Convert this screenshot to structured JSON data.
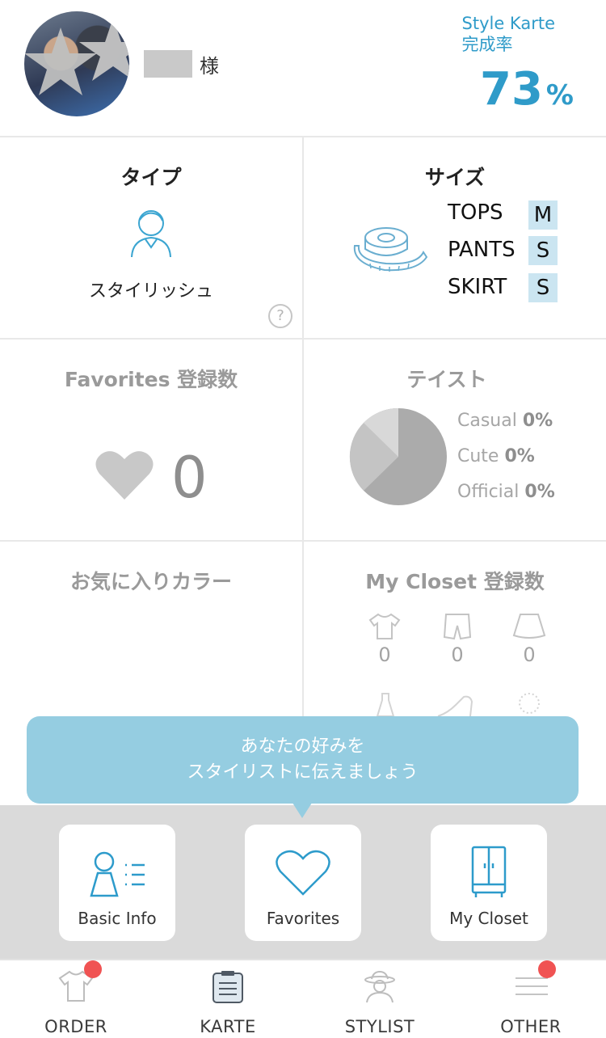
{
  "header": {
    "honorific": "様",
    "karte_title_line1": "Style Karte",
    "karte_title_line2": "完成率",
    "completion_percent": "73",
    "completion_unit": "%"
  },
  "type": {
    "title": "タイプ",
    "label": "スタイリッシュ",
    "help": "?"
  },
  "size": {
    "title": "サイズ",
    "rows": [
      {
        "name": "TOPS",
        "value": "M"
      },
      {
        "name": "PANTS",
        "value": "S"
      },
      {
        "name": "SKIRT",
        "value": "S"
      }
    ]
  },
  "favorites": {
    "title": "Favorites 登録数",
    "count": "0"
  },
  "taste": {
    "title": "テイスト",
    "items": [
      {
        "name": "Casual",
        "value": "0%"
      },
      {
        "name": "Cute",
        "value": "0%"
      },
      {
        "name": "Official",
        "value": "0%"
      }
    ],
    "colors": [
      "#ababab",
      "#c4c4c4",
      "#d8d8d8"
    ]
  },
  "favorite_color": {
    "title": "お気に入りカラー"
  },
  "closet": {
    "title": "My Closet 登録数",
    "counts": [
      "0",
      "0",
      "0"
    ]
  },
  "tooltip": {
    "line1": "あなたの好みを",
    "line2": "スタイリストに伝えましょう"
  },
  "shortcuts": [
    {
      "label": "Basic Info",
      "icon": "basic-info-icon"
    },
    {
      "label": "Favorites",
      "icon": "heart-icon"
    },
    {
      "label": "My Closet",
      "icon": "closet-icon"
    }
  ],
  "tabs": [
    {
      "label": "ORDER",
      "icon": "shirt-icon",
      "badge": true
    },
    {
      "label": "KARTE",
      "icon": "karte-icon",
      "badge": false
    },
    {
      "label": "STYLIST",
      "icon": "stylist-icon",
      "badge": false
    },
    {
      "label": "OTHER",
      "icon": "menu-icon",
      "badge": true
    }
  ],
  "colors": {
    "accent": "#2f9bc9",
    "tooltip": "#95cde1",
    "badge": "#f05353",
    "size_highlight": "#cbe5f1"
  }
}
